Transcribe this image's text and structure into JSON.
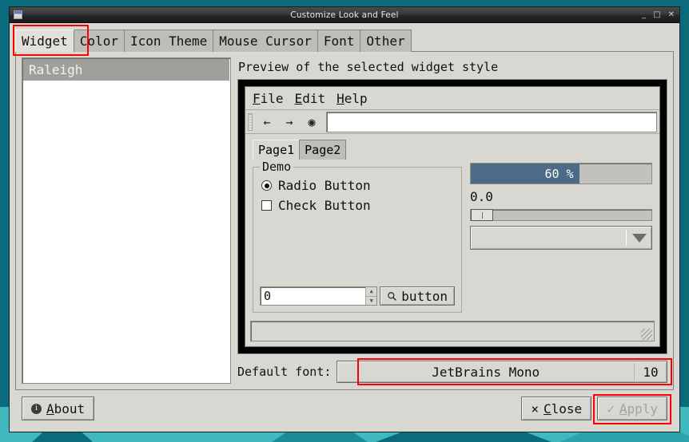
{
  "desktop": {
    "bg_color": "#0b6a7c",
    "accent_color": "#3fb9bd"
  },
  "window": {
    "title": "Customize Look and Feel",
    "icon": "window-icon",
    "controls": {
      "minimize": "_",
      "maximize": "□",
      "close": "✕"
    }
  },
  "tabs": [
    {
      "label": "Widget",
      "active": true,
      "highlighted": true
    },
    {
      "label": "Color",
      "active": false,
      "highlighted": false
    },
    {
      "label": "Icon Theme",
      "active": false,
      "highlighted": false
    },
    {
      "label": "Mouse Cursor",
      "active": false,
      "highlighted": false
    },
    {
      "label": "Font",
      "active": false,
      "highlighted": false
    },
    {
      "label": "Other",
      "active": false,
      "highlighted": false
    }
  ],
  "style_list": {
    "items": [
      {
        "label": "Raleigh",
        "selected": true
      }
    ]
  },
  "preview": {
    "label": "Preview of the selected widget style",
    "menubar": [
      {
        "mnemonic": "F",
        "rest": "ile"
      },
      {
        "mnemonic": "E",
        "rest": "dit"
      },
      {
        "mnemonic": "H",
        "rest": "elp"
      }
    ],
    "toolbar": {
      "back_icon": "←",
      "forward_icon": "→",
      "stop_icon": "◉",
      "address_value": "",
      "address_placeholder": ""
    },
    "inner_tabs": [
      {
        "label": "Page1",
        "active": true
      },
      {
        "label": "Page2",
        "active": false
      }
    ],
    "group": {
      "legend": "Demo",
      "radio_label": "Radio Button",
      "radio_checked": true,
      "check_label": "Check Button",
      "check_checked": false,
      "spin_value": "0",
      "spin_up_icon": "▲",
      "spin_down_icon": "▼",
      "button_label": "button",
      "button_icon": "search-icon"
    },
    "progress": {
      "percent": 60,
      "text": "60 %",
      "fill_color": "#4d6b89"
    },
    "number_value": "0.0",
    "slider": {
      "value": 0,
      "handle_position_percent": 0
    },
    "combo": {
      "value": "",
      "arrow_icon": "chevron-down-icon"
    },
    "statusbar": {
      "text": ""
    }
  },
  "default_font": {
    "label": "Default font:",
    "family": "JetBrains Mono",
    "size": "10",
    "highlighted": true
  },
  "bottom_bar": {
    "about": {
      "label": "About",
      "mnemonic": "A",
      "rest": "bout",
      "icon": "info-icon"
    },
    "close": {
      "label": "Close",
      "mnemonic": "C",
      "rest": "lose",
      "icon": "×"
    },
    "apply": {
      "label": "Apply",
      "mnemonic": "A",
      "rest": "pply",
      "icon": "✓",
      "disabled": true,
      "highlighted": true
    }
  },
  "highlight_color": "#fb0000"
}
